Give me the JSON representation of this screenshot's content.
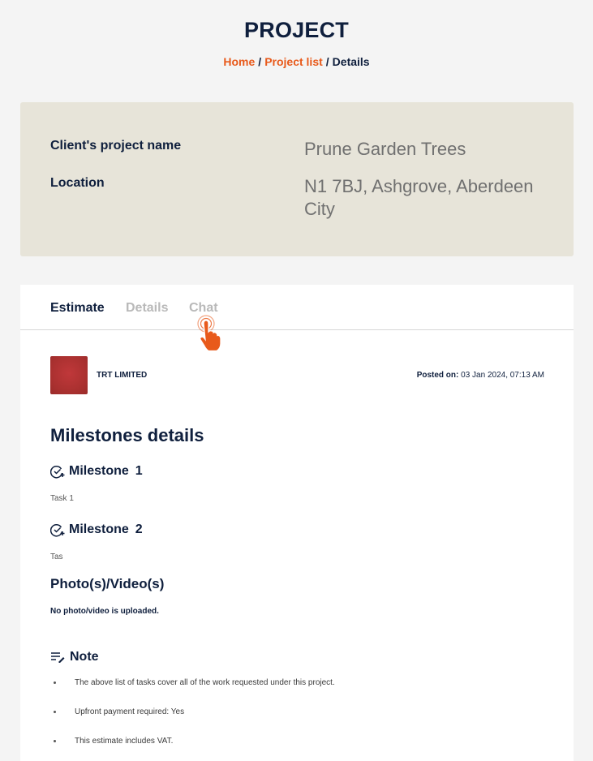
{
  "header": {
    "title": "PROJECT",
    "breadcrumb": {
      "home": "Home",
      "project_list": "Project list",
      "current": "Details",
      "separator": "/"
    }
  },
  "summary": {
    "project_name_label": "Client's project name",
    "project_name_value": "Prune Garden Trees",
    "location_label": "Location",
    "location_value": "N1 7BJ, Ashgrove, Aberdeen City"
  },
  "tabs": [
    {
      "label": "Estimate",
      "active": true
    },
    {
      "label": "Details",
      "active": false
    },
    {
      "label": "Chat",
      "active": false
    }
  ],
  "estimate": {
    "company_name": "TRT LIMITED",
    "posted_label": "Posted on:",
    "posted_value": "03 Jan 2024, 07:13 AM",
    "milestones_heading": "Milestones details",
    "milestones": [
      {
        "label": "Milestone",
        "number": "1",
        "task": "Task 1"
      },
      {
        "label": "Milestone",
        "number": "2",
        "task": "Tas"
      }
    ],
    "photos_heading": "Photo(s)/Video(s)",
    "photos_empty": "No photo/video is uploaded.",
    "note_heading": "Note",
    "notes": [
      "The above list of tasks cover all of the work requested under this project.",
      "Upfront payment required: Yes",
      "This estimate includes VAT."
    ]
  },
  "colors": {
    "accent": "#e85a1b",
    "navy": "#0f1f3d",
    "summary_bg": "#e7e4d9",
    "avatar": "#b33535"
  },
  "icons": {
    "milestone": "check-circle-plus-icon",
    "note": "note-edit-icon",
    "cursor": "pointer-hand-icon"
  }
}
